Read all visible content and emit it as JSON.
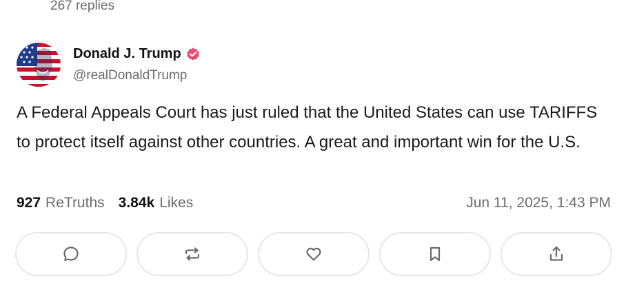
{
  "replies_text": "267 replies",
  "author": {
    "display_name": "Donald J. Trump",
    "handle": "@realDonaldTrump",
    "verified_icon": "verified-badge-icon",
    "verified_color": "#ec4b6c"
  },
  "post": {
    "text": "A Federal Appeals Court has just ruled that the United States can use TARIFFS to protect itself against other countries. A great and important win for the U.S."
  },
  "stats": {
    "retruths_count": "927",
    "retruths_label": "ReTruths",
    "likes_count": "3.84k",
    "likes_label": "Likes",
    "timestamp": "Jun 11, 2025, 1:43 PM"
  },
  "actions": [
    {
      "name": "reply",
      "icon": "chat-bubble-icon"
    },
    {
      "name": "retruth",
      "icon": "repost-icon"
    },
    {
      "name": "like",
      "icon": "heart-icon"
    },
    {
      "name": "bookmark",
      "icon": "bookmark-icon"
    },
    {
      "name": "share",
      "icon": "share-icon"
    }
  ],
  "colors": {
    "icon": "#6b6b6b",
    "border": "#e6e6e6",
    "muted_text": "#6b6b6b"
  }
}
